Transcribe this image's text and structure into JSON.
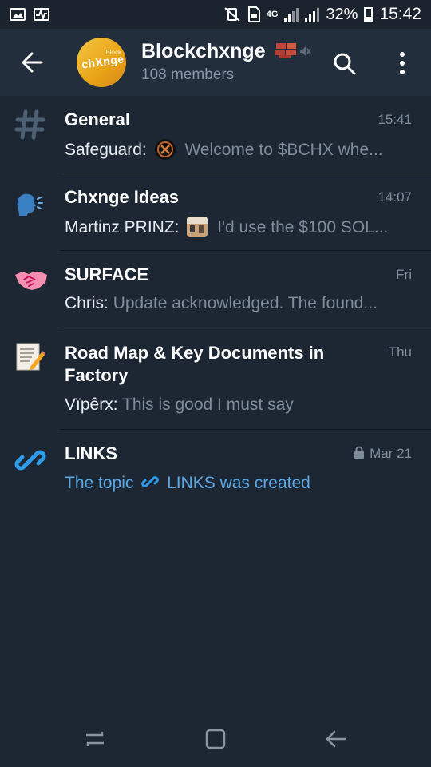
{
  "status_bar": {
    "battery": "32%",
    "time": "15:42",
    "network": "4G"
  },
  "header": {
    "title": "Blockchxnge",
    "subtitle": "108 members",
    "avatar_text": "chXnge",
    "avatar_small": "Block"
  },
  "topics": [
    {
      "name": "General",
      "time": "15:41",
      "sender": "Safeguard:",
      "message": "Welcome to $BCHX  whe..."
    },
    {
      "name": "Chxnge Ideas",
      "time": "14:07",
      "sender": "Martinz PRINZ:",
      "message": "I'd use the $100 SOL..."
    },
    {
      "name": "SURFACE",
      "time": "Fri",
      "sender": "Chris:",
      "message": "Update acknowledged. The found..."
    },
    {
      "name_line1": "Road Map & Key Documents in",
      "name_line2": "Factory",
      "time": "Thu",
      "sender": "Vïpêrx:",
      "message": "This is good I must say"
    },
    {
      "name": "LINKS",
      "time": "Mar 21",
      "message_prefix": "The topic",
      "message_suffix": "LINKS was created"
    }
  ],
  "colors": {
    "background": "#1d2733",
    "header": "#232e3c",
    "accent": "#5aa9e6",
    "muted_text": "#7f8d9b"
  }
}
